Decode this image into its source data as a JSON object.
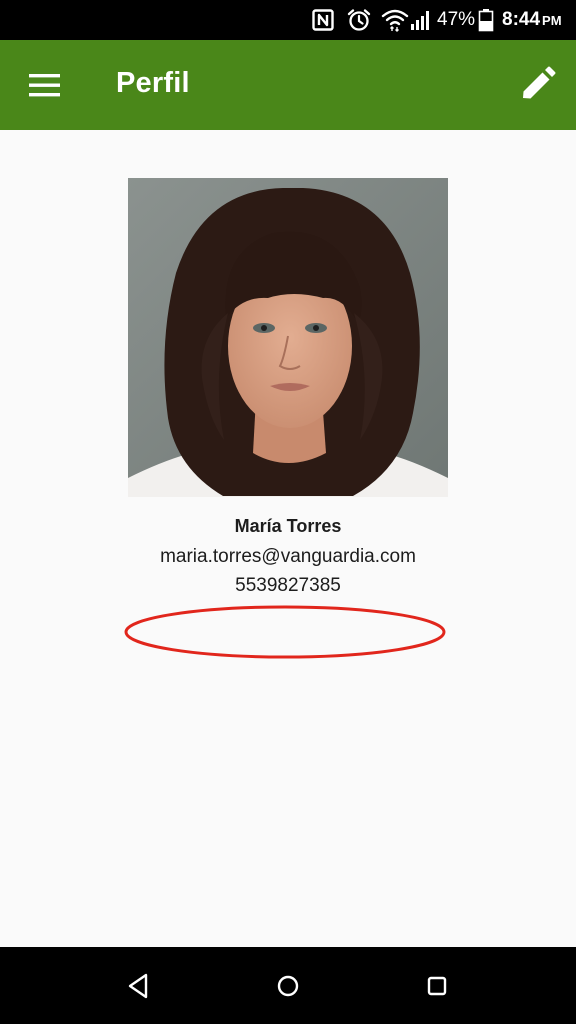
{
  "status_bar": {
    "battery_percent": "47%",
    "time": "8:44",
    "ampm": "PM",
    "icons": [
      "nfc-icon",
      "alarm-icon",
      "wifi-icon",
      "cellular-signal-icon",
      "battery-icon"
    ]
  },
  "app_bar": {
    "title": "Perfil",
    "color": "#4a8719",
    "icons": [
      "menu-icon",
      "pencil-icon"
    ]
  },
  "profile": {
    "name": "María Torres",
    "email": "maria.torres@vanguardia.com",
    "phone": "5539827385"
  },
  "annotation": {
    "color": "#e1261c"
  },
  "nav_bar": {
    "icons": [
      "back-icon",
      "home-icon",
      "recents-icon"
    ]
  }
}
